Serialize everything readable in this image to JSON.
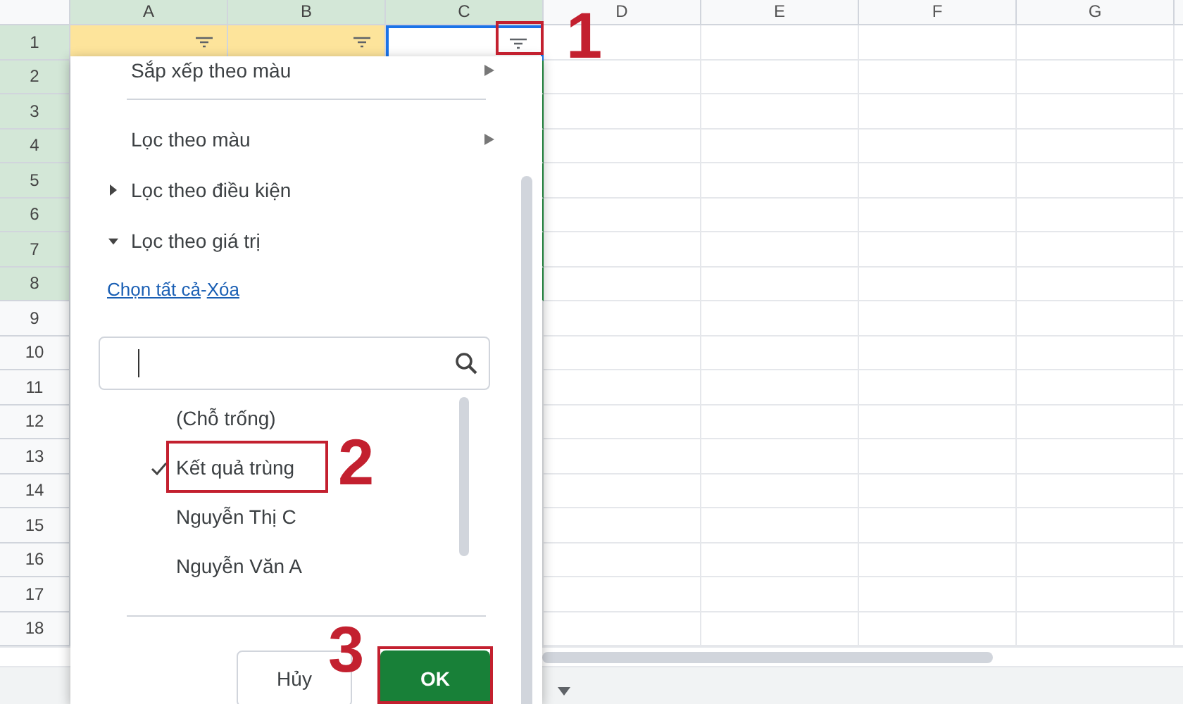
{
  "column_headers": [
    {
      "label": "A",
      "selected": true
    },
    {
      "label": "B",
      "selected": true
    },
    {
      "label": "C",
      "selected": true
    },
    {
      "label": "D",
      "selected": false
    },
    {
      "label": "E",
      "selected": false
    },
    {
      "label": "F",
      "selected": false
    },
    {
      "label": "G",
      "selected": false
    }
  ],
  "row_numbers": [
    {
      "label": "1",
      "selected": true
    },
    {
      "label": "2",
      "selected": true
    },
    {
      "label": "3",
      "selected": true
    },
    {
      "label": "4",
      "selected": true
    },
    {
      "label": "5",
      "selected": true
    },
    {
      "label": "6",
      "selected": true
    },
    {
      "label": "7",
      "selected": true
    },
    {
      "label": "8",
      "selected": true
    },
    {
      "label": "9",
      "selected": false
    },
    {
      "label": "10",
      "selected": false
    },
    {
      "label": "11",
      "selected": false
    },
    {
      "label": "12",
      "selected": false
    },
    {
      "label": "13",
      "selected": false
    },
    {
      "label": "14",
      "selected": false
    },
    {
      "label": "15",
      "selected": false
    },
    {
      "label": "16",
      "selected": false
    },
    {
      "label": "17",
      "selected": false
    },
    {
      "label": "18",
      "selected": false
    }
  ],
  "filter_cells": [
    {
      "selected": false
    },
    {
      "selected": false
    },
    {
      "selected": true
    }
  ],
  "filter_menu": {
    "submenus": [
      "Sắp xếp theo màu",
      "Lọc theo màu"
    ],
    "sections": [
      {
        "label": "Lọc theo điều kiện",
        "expanded": false
      },
      {
        "label": "Lọc theo giá trị",
        "expanded": true
      }
    ],
    "links": [
      "Chọn tất cả",
      "Xóa"
    ],
    "link_separator": "-",
    "values": [
      {
        "label": "(Chỗ trống)",
        "checked": false
      },
      {
        "label": "Kết quả trùng",
        "checked": true
      },
      {
        "label": "Nguyễn Thị C",
        "checked": false
      },
      {
        "label": "Nguyễn Văn A",
        "checked": false
      }
    ],
    "buttons": [
      {
        "label": "Hủy",
        "kind": "secondary"
      },
      {
        "label": "OK",
        "kind": "primary"
      }
    ]
  },
  "annotations": [
    {
      "label": "1"
    },
    {
      "label": "2"
    },
    {
      "label": "3"
    }
  ]
}
